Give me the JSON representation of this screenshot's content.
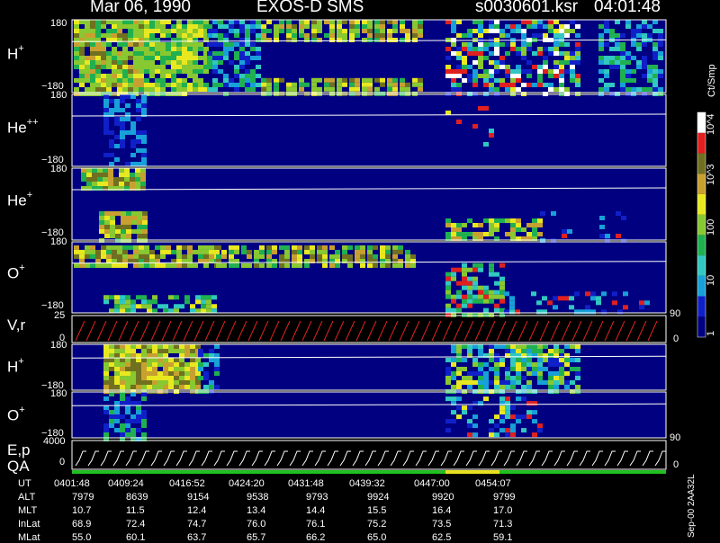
{
  "header": {
    "date": "Mar 06, 1990",
    "instrument": "EXOS-D SMS",
    "file": "s0030601.ksr",
    "time": "04:01:48"
  },
  "colorbar": {
    "unit": "Ct/Smp",
    "ticks": [
      "1",
      "10",
      "100",
      "10^3",
      "10^4"
    ],
    "colors": [
      "#000080",
      "#1020c8",
      "#18a0d8",
      "#30c8c0",
      "#20b050",
      "#88c830",
      "#e8e820",
      "#c8a030",
      "#707020",
      "#e02020",
      "#ffffff"
    ]
  },
  "panels": [
    {
      "id": "h-plus-1",
      "label": "H",
      "sup": "+",
      "ytop": "180",
      "ybot": "−180",
      "right": ""
    },
    {
      "id": "he-pp",
      "label": "He",
      "sup": "++",
      "ytop": "180",
      "ybot": "−180",
      "right": ""
    },
    {
      "id": "he-plus",
      "label": "He",
      "sup": "+",
      "ytop": "180",
      "ybot": "−180",
      "right": ""
    },
    {
      "id": "o-plus-1",
      "label": "O",
      "sup": "+",
      "ytop": "180",
      "ybot": "−180",
      "right": ""
    },
    {
      "id": "vr",
      "label": "V,r",
      "sup": "",
      "ytop": "25",
      "ybot": "0",
      "right_top": "90",
      "right_bot": "0"
    },
    {
      "id": "h-plus-2",
      "label": "H",
      "sup": "+",
      "ytop": "180",
      "ybot": "−180",
      "right": ""
    },
    {
      "id": "o-plus-2",
      "label": "O",
      "sup": "+",
      "ytop": "180",
      "ybot": "−180",
      "right_top": "",
      "right_bot": "90"
    },
    {
      "id": "ep",
      "label": "E,p",
      "sup": "",
      "ytop": "4000",
      "ybot": "0",
      "right_bot": "0"
    }
  ],
  "qa_label": "QA",
  "footer_code": "Sep-00 2AA32L",
  "chart_data": {
    "type": "heatmap",
    "title": "Mar 06, 1990   EXOS-D SMS",
    "x_labels": [
      "0401:48",
      "0409:24",
      "0416:52",
      "0424:20",
      "0431:48",
      "0439:32",
      "0447:00",
      "0454:07"
    ],
    "ephemeris": [
      {
        "name": "UT",
        "values": [
          "0401:48",
          "0409:24",
          "0416:52",
          "0424:20",
          "0431:48",
          "0439:32",
          "0447:00",
          "0454:07"
        ]
      },
      {
        "name": "ALT",
        "values": [
          "7979",
          "8639",
          "9154",
          "9538",
          "9793",
          "9924",
          "9920",
          "9799"
        ]
      },
      {
        "name": "MLT",
        "values": [
          "10.7",
          "11.5",
          "12.4",
          "13.4",
          "14.4",
          "15.5",
          "16.4",
          "17.0"
        ]
      },
      {
        "name": "InLat",
        "values": [
          "68.9",
          "72.4",
          "74.7",
          "76.0",
          "76.1",
          "75.2",
          "73.5",
          "71.3"
        ]
      },
      {
        "name": "MLat",
        "values": [
          "55.0",
          "60.1",
          "63.7",
          "65.7",
          "66.2",
          "65.0",
          "62.5",
          "59.1"
        ]
      }
    ],
    "color_scale": {
      "min": 1,
      "max": 10000,
      "log": true,
      "unit": "Ct/Smp"
    }
  }
}
